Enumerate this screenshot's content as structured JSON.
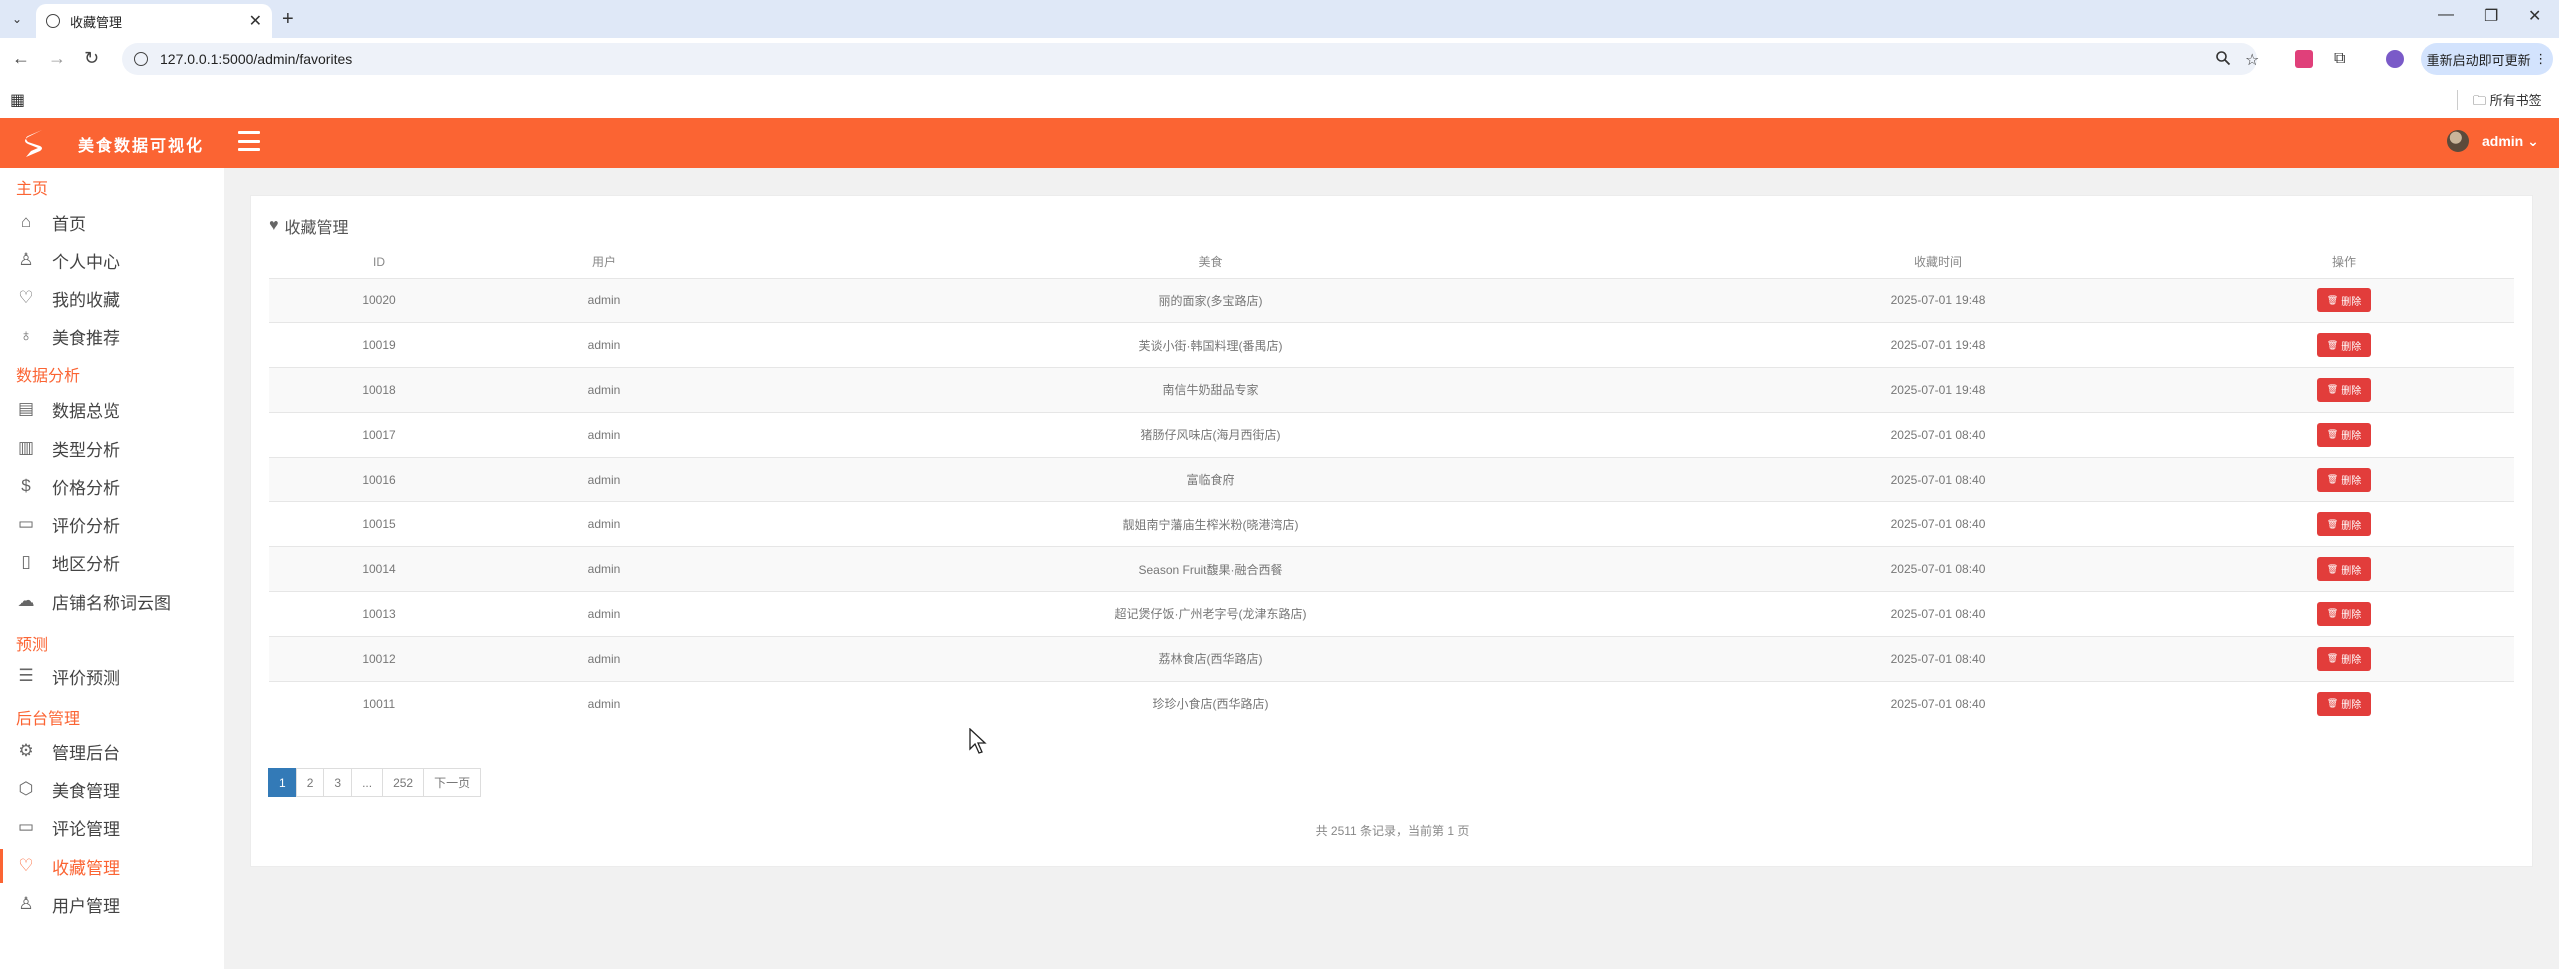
{
  "browser": {
    "tab_title": "收藏管理",
    "url": "127.0.0.1:5000/admin/favorites",
    "update_button": "重新启动即可更新",
    "all_bookmarks": "所有书签",
    "new_tab": "+",
    "tab_close": "✕"
  },
  "header": {
    "brand": "美食数据可视化",
    "user": "admin"
  },
  "sidebar": {
    "groups": [
      {
        "label": "主页"
      },
      {
        "label": "数据分析"
      },
      {
        "label": "预测"
      },
      {
        "label": "后台管理"
      }
    ],
    "items": [
      {
        "label": "首页",
        "icon": "home-icon"
      },
      {
        "label": "个人中心",
        "icon": "user-icon"
      },
      {
        "label": "我的收藏",
        "icon": "heart-icon"
      },
      {
        "label": "美食推荐",
        "icon": "bulb-icon"
      },
      {
        "label": "数据总览",
        "icon": "layout-icon"
      },
      {
        "label": "类型分析",
        "icon": "bar-chart-icon"
      },
      {
        "label": "价格分析",
        "icon": "dollar-icon"
      },
      {
        "label": "评价分析",
        "icon": "comment-icon"
      },
      {
        "label": "地区分析",
        "icon": "map-icon"
      },
      {
        "label": "店铺名称词云图",
        "icon": "cloud-icon"
      },
      {
        "label": "评价预测",
        "icon": "list-icon"
      },
      {
        "label": "管理后台",
        "icon": "gear-icon"
      },
      {
        "label": "美食管理",
        "icon": "box-icon"
      },
      {
        "label": "评论管理",
        "icon": "message-icon"
      },
      {
        "label": "收藏管理",
        "icon": "heart-pulse-icon",
        "active": true
      },
      {
        "label": "用户管理",
        "icon": "user-icon"
      }
    ]
  },
  "main": {
    "title": "收藏管理",
    "columns": [
      "ID",
      "用户",
      "美食",
      "收藏时间",
      "操作"
    ],
    "delete_label": "删除",
    "rows": [
      {
        "id": "10020",
        "user": "admin",
        "food": "丽的面家(多宝路店)",
        "time": "2025-07-01 19:48"
      },
      {
        "id": "10019",
        "user": "admin",
        "food": "芙谈小街·韩国料理(番禺店)",
        "time": "2025-07-01 19:48"
      },
      {
        "id": "10018",
        "user": "admin",
        "food": "南信牛奶甜品专家",
        "time": "2025-07-01 19:48"
      },
      {
        "id": "10017",
        "user": "admin",
        "food": "猪肠仔风味店(海月西街店)",
        "time": "2025-07-01 08:40"
      },
      {
        "id": "10016",
        "user": "admin",
        "food": "富临食府",
        "time": "2025-07-01 08:40"
      },
      {
        "id": "10015",
        "user": "admin",
        "food": "靓姐南宁藩庙生榨米粉(晓港湾店)",
        "time": "2025-07-01 08:40"
      },
      {
        "id": "10014",
        "user": "admin",
        "food": "Season Fruit馥果·融合西餐",
        "time": "2025-07-01 08:40"
      },
      {
        "id": "10013",
        "user": "admin",
        "food": "超记煲仔饭·广州老字号(龙津东路店)",
        "time": "2025-07-01 08:40"
      },
      {
        "id": "10012",
        "user": "admin",
        "food": "荔林食店(西华路店)",
        "time": "2025-07-01 08:40"
      },
      {
        "id": "10011",
        "user": "admin",
        "food": "珍珍小食店(西华路店)",
        "time": "2025-07-01 08:40"
      }
    ],
    "pagination": {
      "pages": [
        "1",
        "2",
        "3",
        "...",
        "252"
      ],
      "next": "下一页",
      "current": "1"
    },
    "summary": "共 2511 条记录，当前第 1 页"
  }
}
